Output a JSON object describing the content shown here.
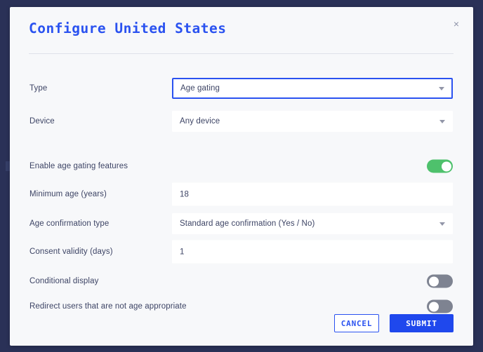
{
  "colors": {
    "backdrop": "#2a3157",
    "modal_bg": "#f7f8fa",
    "accent_blue": "#2a52f0",
    "submit_blue": "#1f48ed",
    "toggle_on_green": "#4ec16c",
    "toggle_off_gray": "#7e8391",
    "label_text": "#3d4465",
    "divider": "#dfe2ea"
  },
  "dialog": {
    "title": "Configure United States",
    "close_icon": "close-icon",
    "close_label": "×"
  },
  "fields": [
    {
      "key": "type",
      "label": "Type",
      "control": "select",
      "value": "Age gating",
      "focused": true,
      "icon": "chevron-down-icon"
    },
    {
      "key": "device",
      "label": "Device",
      "control": "select",
      "value": "Any device",
      "focused": false,
      "icon": "chevron-down-icon"
    },
    {
      "key": "enable_age_gating_features",
      "label": "Enable age gating features",
      "control": "toggle",
      "value": "on"
    },
    {
      "key": "minimum_age",
      "label": "Minimum age (years)",
      "control": "text",
      "value": "18",
      "placeholder": ""
    },
    {
      "key": "age_confirmation_type",
      "label": "Age confirmation type",
      "control": "select",
      "value": "Standard age confirmation (Yes / No)",
      "focused": false,
      "icon": "chevron-down-icon"
    },
    {
      "key": "consent_validity",
      "label": "Consent validity (days)",
      "control": "text",
      "value": "1",
      "placeholder": ""
    },
    {
      "key": "conditional_display",
      "label": "Conditional display",
      "control": "toggle",
      "value": "off"
    },
    {
      "key": "redirect_users",
      "label": "Redirect users that are not age appropriate",
      "control": "toggle",
      "value": "off"
    }
  ],
  "footer": {
    "cancel_label": "CANCEL",
    "submit_label": "SUBMIT"
  }
}
